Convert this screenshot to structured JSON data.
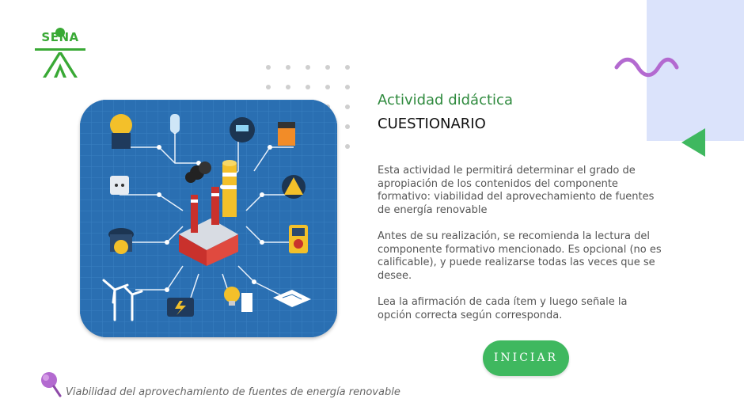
{
  "logo": {
    "text": "SENA"
  },
  "activity": {
    "subtitle": "Actividad didáctica",
    "title": "CUESTIONARIO"
  },
  "paragraphs": [
    "Esta actividad le permitirá determinar el grado de apropiación de los contenidos del componente formativo: viabilidad del aprovechamiento de fuentes de energía renovable",
    "Antes de su realización, se recomienda la lectura del componente formativo mencionado.  Es opcional (no es calificable), y puede realizarse todas las veces que se desee.",
    "Lea la afirmación de cada ítem y luego señale la opción correcta según corresponda."
  ],
  "button": {
    "label": "INICIAR"
  },
  "footer": {
    "text": "Viabilidad del aprovechamiento de fuentes de energía renovable"
  },
  "illustration_labels": [
    "ELECTRICIAN",
    "LIGHT BULB",
    "ELECTRIC METER",
    "BATTERY",
    "ELECTRIC APPLIANCES",
    "DANGER",
    "POWER STATION",
    "MULTIMETER",
    "WIND TURBINE",
    "ELECTRICIAN TOOLBOX",
    "ELECTRIC APPLIANCES",
    "CIRCUIT"
  ],
  "colors": {
    "accent_green": "#3fb85f",
    "subtitle_green": "#2f8a3e",
    "panel_blue": "#dbe3fb",
    "wave_purple": "#b36ad0",
    "illustration_bg": "#2a6fb2"
  }
}
